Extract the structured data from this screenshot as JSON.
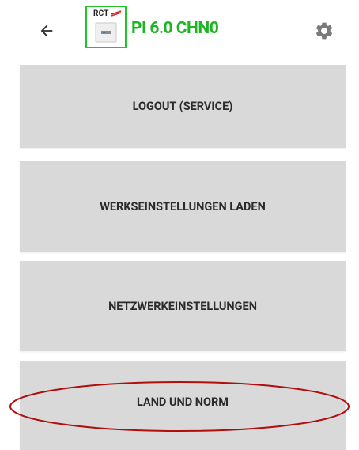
{
  "header": {
    "back_icon": "arrow-left-icon",
    "logo_text": "RCT",
    "device_title": "PI 6.0 CHN0",
    "settings_icon": "gear-icon",
    "accent_color": "#1cb623"
  },
  "menu": {
    "items": [
      {
        "label": "LOGOUT (SERVICE)"
      },
      {
        "label": "WERKSEINSTELLUNGEN LADEN"
      },
      {
        "label": "NETZWERKEINSTELLUNGEN"
      },
      {
        "label": "LAND UND NORM"
      }
    ]
  },
  "annotation": {
    "highlight_color": "#b00d0d"
  }
}
